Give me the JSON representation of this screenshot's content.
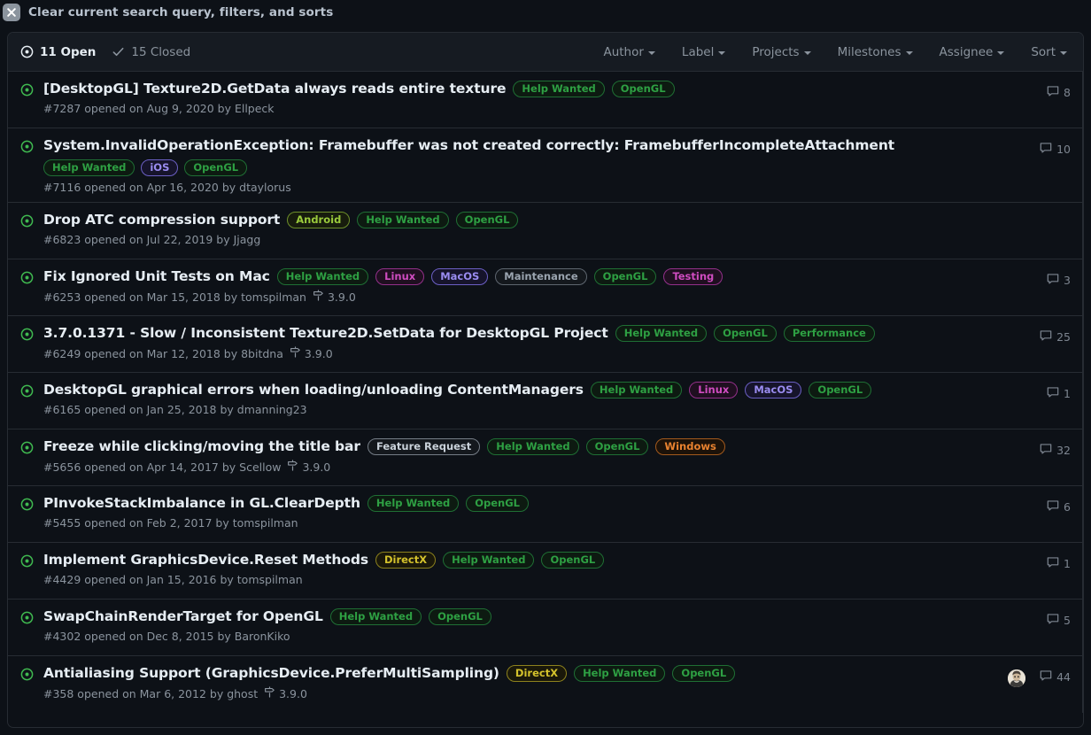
{
  "topbar": {
    "close_icon": "close-icon",
    "label": "Clear current search query, filters, and sorts"
  },
  "header": {
    "open": {
      "icon": "issue-opened-icon",
      "label": "11 Open"
    },
    "closed": {
      "icon": "check-icon",
      "label": "15 Closed"
    },
    "filters": [
      {
        "label": "Author"
      },
      {
        "label": "Label"
      },
      {
        "label": "Projects"
      },
      {
        "label": "Milestones"
      },
      {
        "label": "Assignee"
      },
      {
        "label": "Sort"
      }
    ]
  },
  "label_colors": {
    "Help Wanted": {
      "text": "#2ea043",
      "border": "#1f6f34",
      "bg": "#0d1a11"
    },
    "OpenGL": {
      "text": "#2ea043",
      "border": "#1f6f34",
      "bg": "#0d1a11"
    },
    "Performance": {
      "text": "#2ea043",
      "border": "#1f6f34",
      "bg": "#0d1a11"
    },
    "iOS": {
      "text": "#9a8cf0",
      "border": "#6b5fc4",
      "bg": "#16142b"
    },
    "MacOS": {
      "text": "#9a8cf0",
      "border": "#6b5fc4",
      "bg": "#16142b"
    },
    "Android": {
      "text": "#9aca3c",
      "border": "#6d8f2a",
      "bg": "#171c0d"
    },
    "Linux": {
      "text": "#cf4cc0",
      "border": "#93308a",
      "bg": "#1f0f20"
    },
    "Testing": {
      "text": "#cf4cc0",
      "border": "#93308a",
      "bg": "#1f0f20"
    },
    "Maintenance": {
      "text": "#9aa4af",
      "border": "#5e666f",
      "bg": "#14181d"
    },
    "Feature Request": {
      "text": "#c9d1d9",
      "border": "#767e87",
      "bg": "#14181d"
    },
    "Windows": {
      "text": "#e8822f",
      "border": "#a35a1d",
      "bg": "#1c1209"
    },
    "DirectX": {
      "text": "#d4c22c",
      "border": "#8d821d",
      "bg": "#1a180a"
    }
  },
  "issues": [
    {
      "state_icon": "issue-opened-icon",
      "title": "[DesktopGL] Texture2D.GetData always reads entire texture",
      "labels": [
        "Help Wanted",
        "OpenGL"
      ],
      "labels_inline": true,
      "meta": "#7287 opened on Aug 9, 2020 by Ellpeck",
      "milestone": "",
      "assignee": false,
      "comments": "8"
    },
    {
      "state_icon": "issue-opened-icon",
      "title": "System.InvalidOperationException: Framebuffer was not created correctly: FramebufferIncompleteAttachment",
      "labels": [
        "Help Wanted",
        "iOS",
        "OpenGL"
      ],
      "labels_inline": false,
      "meta": "#7116 opened on Apr 16, 2020 by dtaylorus",
      "milestone": "",
      "assignee": false,
      "comments": "10"
    },
    {
      "state_icon": "issue-opened-icon",
      "title": "Drop ATC compression support",
      "labels": [
        "Android",
        "Help Wanted",
        "OpenGL"
      ],
      "labels_inline": true,
      "meta": "#6823 opened on Jul 22, 2019 by Jjagg",
      "milestone": "",
      "assignee": false,
      "comments": ""
    },
    {
      "state_icon": "issue-opened-icon",
      "title": "Fix Ignored Unit Tests on Mac",
      "labels": [
        "Help Wanted",
        "Linux",
        "MacOS",
        "Maintenance",
        "OpenGL",
        "Testing"
      ],
      "labels_inline": true,
      "meta": "#6253 opened on Mar 15, 2018 by tomspilman",
      "milestone": "3.9.0",
      "assignee": false,
      "comments": "3"
    },
    {
      "state_icon": "issue-opened-icon",
      "title": "3.7.0.1371 - Slow / Inconsistent Texture2D.SetData for DesktopGL Project",
      "labels": [
        "Help Wanted",
        "OpenGL",
        "Performance"
      ],
      "labels_inline": true,
      "meta": "#6249 opened on Mar 12, 2018 by 8bitdna",
      "milestone": "3.9.0",
      "assignee": false,
      "comments": "25"
    },
    {
      "state_icon": "issue-opened-icon",
      "title": "DesktopGL graphical errors when loading/unloading ContentManagers",
      "labels": [
        "Help Wanted",
        "Linux",
        "MacOS",
        "OpenGL"
      ],
      "labels_inline": true,
      "meta": "#6165 opened on Jan 25, 2018 by dmanning23",
      "milestone": "",
      "assignee": false,
      "comments": "1"
    },
    {
      "state_icon": "issue-opened-icon",
      "title": "Freeze while clicking/moving the title bar",
      "labels": [
        "Feature Request",
        "Help Wanted",
        "OpenGL",
        "Windows"
      ],
      "labels_inline": true,
      "meta": "#5656 opened on Apr 14, 2017 by Scellow",
      "milestone": "3.9.0",
      "assignee": false,
      "comments": "32"
    },
    {
      "state_icon": "issue-opened-icon",
      "title": "PInvokeStackImbalance in GL.ClearDepth",
      "labels": [
        "Help Wanted",
        "OpenGL"
      ],
      "labels_inline": true,
      "meta": "#5455 opened on Feb 2, 2017 by tomspilman",
      "milestone": "",
      "assignee": false,
      "comments": "6"
    },
    {
      "state_icon": "issue-opened-icon",
      "title": "Implement GraphicsDevice.Reset Methods",
      "labels": [
        "DirectX",
        "Help Wanted",
        "OpenGL"
      ],
      "labels_inline": true,
      "meta": "#4429 opened on Jan 15, 2016 by tomspilman",
      "milestone": "",
      "assignee": false,
      "comments": "1"
    },
    {
      "state_icon": "issue-opened-icon",
      "title": "SwapChainRenderTarget for OpenGL",
      "labels": [
        "Help Wanted",
        "OpenGL"
      ],
      "labels_inline": true,
      "meta": "#4302 opened on Dec 8, 2015 by BaronKiko",
      "milestone": "",
      "assignee": false,
      "comments": "5"
    },
    {
      "state_icon": "issue-opened-icon",
      "title": "Antialiasing Support (GraphicsDevice.PreferMultiSampling)",
      "labels": [
        "DirectX",
        "Help Wanted",
        "OpenGL"
      ],
      "labels_inline": true,
      "meta": "#358 opened on Mar 6, 2012 by ghost",
      "milestone": "3.9.0",
      "assignee": true,
      "comments": "44"
    }
  ]
}
